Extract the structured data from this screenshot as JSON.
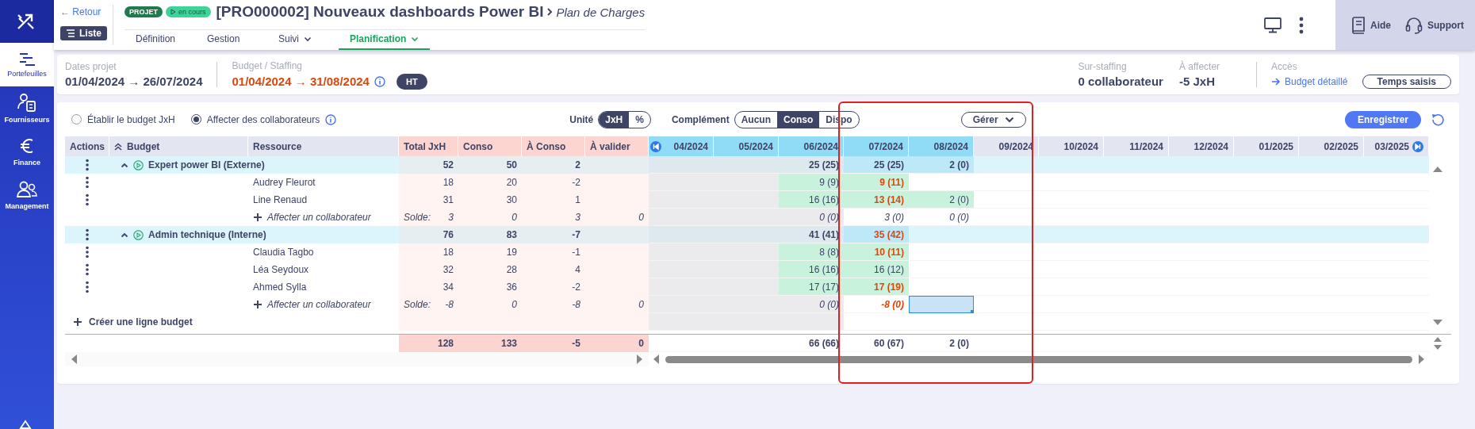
{
  "sidebar": {
    "items": [
      {
        "label": "Portefeuilles",
        "selected": true
      },
      {
        "label": "Fournisseurs",
        "selected": false
      },
      {
        "label": "Finance",
        "selected": false
      },
      {
        "label": "Management",
        "selected": false
      }
    ]
  },
  "header": {
    "back": "← Retour",
    "list_button": "Liste",
    "badges": [
      {
        "kind": "type",
        "label": "PROJET"
      },
      {
        "kind": "status",
        "label": "en cours"
      }
    ],
    "title": "[PRO000002] Nouveaux dashboards Power BI",
    "subtitle": "Plan de Charges",
    "tabs": [
      {
        "label": "Définition",
        "dropdown": false,
        "selected": false
      },
      {
        "label": "Gestion",
        "dropdown": false,
        "selected": false
      },
      {
        "label": "Suivi",
        "dropdown": true,
        "selected": false
      },
      {
        "label": "Planification",
        "dropdown": true,
        "selected": true
      }
    ],
    "help": "Aide",
    "support": "Support"
  },
  "summary": {
    "dates_label": "Dates projet",
    "dates": "01/04/2024 → 26/07/2024",
    "budget_label": "Budget / Staffing",
    "budget_dates": "01/04/2024 → 31/08/2024",
    "budget_alert": true,
    "tax_badge": "HT",
    "overstaffing_label": "Sur-staffing",
    "overstaffing": "0 collaborateur",
    "to_assign_label": "À affecter",
    "to_assign": "-5 JxH",
    "access_label": "Accès",
    "access_link": "Budget détaillé",
    "access_button": "Temps saisis"
  },
  "toolbar": {
    "modes": [
      {
        "label": "Établir le budget JxH",
        "selected": false
      },
      {
        "label": "Affecter des collaborateurs",
        "selected": true
      }
    ],
    "unit_label": "Unité",
    "units": [
      {
        "label": "JxH",
        "selected": true
      },
      {
        "label": "%",
        "selected": false
      }
    ],
    "complement_label": "Complément",
    "complements": [
      {
        "label": "Aucun",
        "selected": false
      },
      {
        "label": "Conso",
        "selected": true
      },
      {
        "label": "Dispo",
        "selected": false
      }
    ],
    "manage_button": "Gérer",
    "save_button": "Enregistrer"
  },
  "table": {
    "columns": [
      "Actions",
      "Budget",
      "Ressource",
      "Total JxH",
      "Conso",
      "À Conso",
      "À valider"
    ],
    "months": [
      {
        "label": "04/2024",
        "in_period": true
      },
      {
        "label": "05/2024",
        "in_period": true
      },
      {
        "label": "06/2024",
        "in_period": true
      },
      {
        "label": "07/2024",
        "in_period": true
      },
      {
        "label": "08/2024",
        "in_period": true
      },
      {
        "label": "09/2024",
        "in_period": false
      },
      {
        "label": "10/2024",
        "in_period": false
      },
      {
        "label": "11/2024",
        "in_period": false
      },
      {
        "label": "12/2024",
        "in_period": false
      },
      {
        "label": "01/2025",
        "in_period": false
      },
      {
        "label": "02/2025",
        "in_period": false
      },
      {
        "label": "03/2025",
        "in_period": false
      }
    ],
    "rows": [
      {
        "kind": "group",
        "name": "Expert power BI (Externe)",
        "expanded": true,
        "total": "52",
        "conso": "50",
        "a_conso": "2",
        "months": [
          {
            "kind": "past"
          },
          {
            "kind": "past"
          },
          {
            "kind": "past",
            "text": "25 (25)",
            "alert": false
          },
          {
            "kind": "period",
            "text": "25 (25)",
            "alert": false
          },
          {
            "kind": "period",
            "text": "2 (0)",
            "alert": false
          },
          {
            "kind": "open"
          },
          {
            "kind": "open"
          },
          {
            "kind": "open"
          },
          {
            "kind": "open"
          },
          {
            "kind": "open"
          },
          {
            "kind": "open"
          },
          {
            "kind": "open"
          }
        ]
      },
      {
        "kind": "person",
        "resource": "Audrey Fleurot",
        "total": "18",
        "conso": "20",
        "a_conso": "-2",
        "months": [
          {
            "kind": "past"
          },
          {
            "kind": "past"
          },
          {
            "kind": "staffed",
            "text": "9 (9)",
            "alert": false
          },
          {
            "kind": "staffed",
            "text": "9 (11)",
            "alert": true
          },
          {
            "kind": "open"
          },
          {
            "kind": "open"
          },
          {
            "kind": "open"
          },
          {
            "kind": "open"
          },
          {
            "kind": "open"
          },
          {
            "kind": "open"
          },
          {
            "kind": "open"
          },
          {
            "kind": "open"
          }
        ]
      },
      {
        "kind": "person",
        "resource": "Line Renaud",
        "total": "31",
        "conso": "30",
        "a_conso": "1",
        "months": [
          {
            "kind": "past"
          },
          {
            "kind": "past"
          },
          {
            "kind": "staffed",
            "text": "16 (16)",
            "alert": false
          },
          {
            "kind": "staffed",
            "text": "13 (14)",
            "alert": true
          },
          {
            "kind": "staffed",
            "text": "2 (0)",
            "alert": false
          },
          {
            "kind": "open"
          },
          {
            "kind": "open"
          },
          {
            "kind": "open"
          },
          {
            "kind": "open"
          },
          {
            "kind": "open"
          },
          {
            "kind": "open"
          },
          {
            "kind": "open"
          }
        ]
      },
      {
        "kind": "add",
        "label": "Affecter un collaborateur",
        "solde_label": "Solde:",
        "total": "3",
        "conso": "0",
        "a_conso": "3",
        "a_valider": "0",
        "months": [
          {
            "kind": "past"
          },
          {
            "kind": "past"
          },
          {
            "kind": "past",
            "text": "0 (0)",
            "alert": false
          },
          {
            "kind": "open",
            "text": "3 (0)",
            "alert": false
          },
          {
            "kind": "open",
            "text": "0 (0)",
            "alert": false
          },
          {
            "kind": "open"
          },
          {
            "kind": "open"
          },
          {
            "kind": "open"
          },
          {
            "kind": "open"
          },
          {
            "kind": "open"
          },
          {
            "kind": "open"
          },
          {
            "kind": "open"
          }
        ]
      },
      {
        "kind": "group",
        "name": "Admin technique (Interne)",
        "expanded": true,
        "total": "76",
        "conso": "83",
        "a_conso": "-7",
        "months": [
          {
            "kind": "past"
          },
          {
            "kind": "past"
          },
          {
            "kind": "past",
            "text": "41 (41)",
            "alert": false
          },
          {
            "kind": "period",
            "text": "35 (42)",
            "alert": true
          },
          {
            "kind": "open"
          },
          {
            "kind": "open"
          },
          {
            "kind": "open"
          },
          {
            "kind": "open"
          },
          {
            "kind": "open"
          },
          {
            "kind": "open"
          },
          {
            "kind": "open"
          },
          {
            "kind": "open"
          }
        ]
      },
      {
        "kind": "person",
        "resource": "Claudia Tagbo",
        "total": "18",
        "conso": "19",
        "a_conso": "-1",
        "months": [
          {
            "kind": "past"
          },
          {
            "kind": "past"
          },
          {
            "kind": "staffed",
            "text": "8 (8)",
            "alert": false
          },
          {
            "kind": "staffed",
            "text": "10 (11)",
            "alert": true
          },
          {
            "kind": "open"
          },
          {
            "kind": "open"
          },
          {
            "kind": "open"
          },
          {
            "kind": "open"
          },
          {
            "kind": "open"
          },
          {
            "kind": "open"
          },
          {
            "kind": "open"
          },
          {
            "kind": "open"
          }
        ]
      },
      {
        "kind": "person",
        "resource": "Léa Seydoux",
        "total": "32",
        "conso": "28",
        "a_conso": "4",
        "months": [
          {
            "kind": "past"
          },
          {
            "kind": "past"
          },
          {
            "kind": "staffed",
            "text": "16 (16)",
            "alert": false
          },
          {
            "kind": "staffed",
            "text": "16 (12)",
            "alert": false
          },
          {
            "kind": "open"
          },
          {
            "kind": "open"
          },
          {
            "kind": "open"
          },
          {
            "kind": "open"
          },
          {
            "kind": "open"
          },
          {
            "kind": "open"
          },
          {
            "kind": "open"
          },
          {
            "kind": "open"
          }
        ]
      },
      {
        "kind": "person",
        "resource": "Ahmed Sylla",
        "total": "34",
        "conso": "36",
        "a_conso": "-2",
        "months": [
          {
            "kind": "past"
          },
          {
            "kind": "past"
          },
          {
            "kind": "staffed",
            "text": "17 (17)",
            "alert": false
          },
          {
            "kind": "staffed",
            "text": "17 (19)",
            "alert": true
          },
          {
            "kind": "open"
          },
          {
            "kind": "open"
          },
          {
            "kind": "open"
          },
          {
            "kind": "open"
          },
          {
            "kind": "open"
          },
          {
            "kind": "open"
          },
          {
            "kind": "open"
          },
          {
            "kind": "open"
          }
        ]
      },
      {
        "kind": "add",
        "label": "Affecter un collaborateur",
        "solde_label": "Solde:",
        "total": "-8",
        "conso": "0",
        "a_conso": "-8",
        "a_valider": "0",
        "months": [
          {
            "kind": "past"
          },
          {
            "kind": "past"
          },
          {
            "kind": "past",
            "text": "0 (0)",
            "alert": false
          },
          {
            "kind": "open",
            "text": "-8 (0)",
            "alert": true
          },
          {
            "kind": "selected"
          },
          {
            "kind": "open"
          },
          {
            "kind": "open"
          },
          {
            "kind": "open"
          },
          {
            "kind": "open"
          },
          {
            "kind": "open"
          },
          {
            "kind": "open"
          },
          {
            "kind": "open"
          }
        ]
      },
      {
        "kind": "create",
        "text": "Créer une ligne budget",
        "months": [
          {
            "kind": "past"
          },
          {
            "kind": "past"
          },
          {
            "kind": "past"
          },
          {
            "kind": "open"
          },
          {
            "kind": "open"
          },
          {
            "kind": "open"
          },
          {
            "kind": "open"
          },
          {
            "kind": "open"
          },
          {
            "kind": "open"
          },
          {
            "kind": "open"
          },
          {
            "kind": "open"
          },
          {
            "kind": "open"
          }
        ]
      }
    ],
    "totals": {
      "total": "128",
      "conso": "133",
      "a_conso": "-5",
      "a_valider": "0",
      "months": [
        {
          "kind": "blank"
        },
        {
          "kind": "blank"
        },
        {
          "kind": "value",
          "text": "66 (66)"
        },
        {
          "kind": "value",
          "text": "60 (67)"
        },
        {
          "kind": "value",
          "text": "2 (0)"
        },
        {
          "kind": "blank"
        },
        {
          "kind": "blank"
        },
        {
          "kind": "blank"
        },
        {
          "kind": "blank"
        },
        {
          "kind": "blank"
        },
        {
          "kind": "blank"
        },
        {
          "kind": "blank"
        }
      ]
    }
  }
}
